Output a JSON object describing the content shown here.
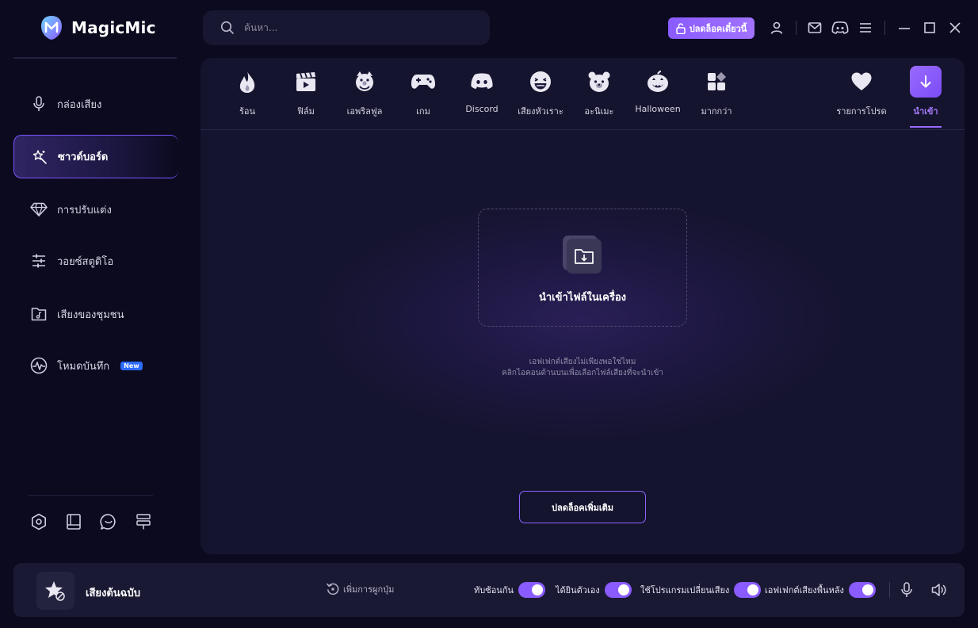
{
  "app": {
    "name": "MagicMic"
  },
  "search": {
    "placeholder": "ค้นหา..."
  },
  "header": {
    "unlock_today_label": "ปลดล็อคเดี๋ยวนี้",
    "icons": [
      "user-icon",
      "mail-icon",
      "discord-icon",
      "menu-icon",
      "minimize-icon",
      "maximize-icon",
      "close-icon"
    ]
  },
  "sidebar": {
    "items": [
      {
        "label": "กล่องเสียง",
        "icon": "microphone-icon"
      },
      {
        "label": "ซาวด์บอร์ด",
        "icon": "magic-wand-icon",
        "active": true
      },
      {
        "label": "การปรับแต่ง",
        "icon": "diamond-icon"
      },
      {
        "label": "วอยซ์สตูดิโอ",
        "icon": "sliders-icon"
      },
      {
        "label": "เสียงของชุมชน",
        "icon": "music-folder-icon"
      },
      {
        "label": "โหมดบันทึก",
        "icon": "waveform-icon",
        "badge": "New"
      }
    ],
    "bottom_icons": [
      "settings-icon",
      "book-icon",
      "chat-icon",
      "feedback-icon"
    ]
  },
  "categories": [
    {
      "label": "ร้อน",
      "icon": "fire-icon"
    },
    {
      "label": "ฟิล์ม",
      "icon": "clapperboard-icon"
    },
    {
      "label": "เอพริลฟูล",
      "icon": "clown-icon"
    },
    {
      "label": "เกม",
      "icon": "gamepad-icon"
    },
    {
      "label": "Discord",
      "icon": "discord-icon"
    },
    {
      "label": "เสียงหัวเราะ",
      "icon": "laughing-face-icon"
    },
    {
      "label": "อะนิเมะ",
      "icon": "bear-icon"
    },
    {
      "label": "Halloween",
      "icon": "pumpkin-icon"
    },
    {
      "label": "มากกว่า",
      "icon": "grid-icon"
    },
    {
      "label": "รายการโปรด",
      "icon": "heart-icon"
    },
    {
      "label": "นำเข้า",
      "icon": "download-icon",
      "active": true
    }
  ],
  "import_panel": {
    "title": "นำเข้าไฟล์ในเครื่อง",
    "hint_line1": "เอฟเฟกต์เสียงไม่เพียงพอใช่ไหม",
    "hint_line2": "คลิกไอคอนด้านบนเพื่อเลือกไฟล์เสียงที่จะนำเข้า",
    "unlock_more_label": "ปลดล็อคเพิ่มเติม"
  },
  "bottom_bar": {
    "original_voice_label": "เสียงต้นฉบับ",
    "add_hotkey_label": "เพิ่มการผูกปุ่ม",
    "toggles": [
      {
        "label": "ทับซ้อนกัน",
        "on": true
      },
      {
        "label": "ได้ยินตัวเอง",
        "on": true
      },
      {
        "label": "ใช้โปรแกรมเปลี่ยนเสียง",
        "on": true
      },
      {
        "label": "เอฟเฟกต์เสียงพื้นหลัง",
        "on": true
      }
    ]
  },
  "colors": {
    "accent": "#8a5bff",
    "background": "#0b0a1f",
    "panel": "#15142e"
  }
}
